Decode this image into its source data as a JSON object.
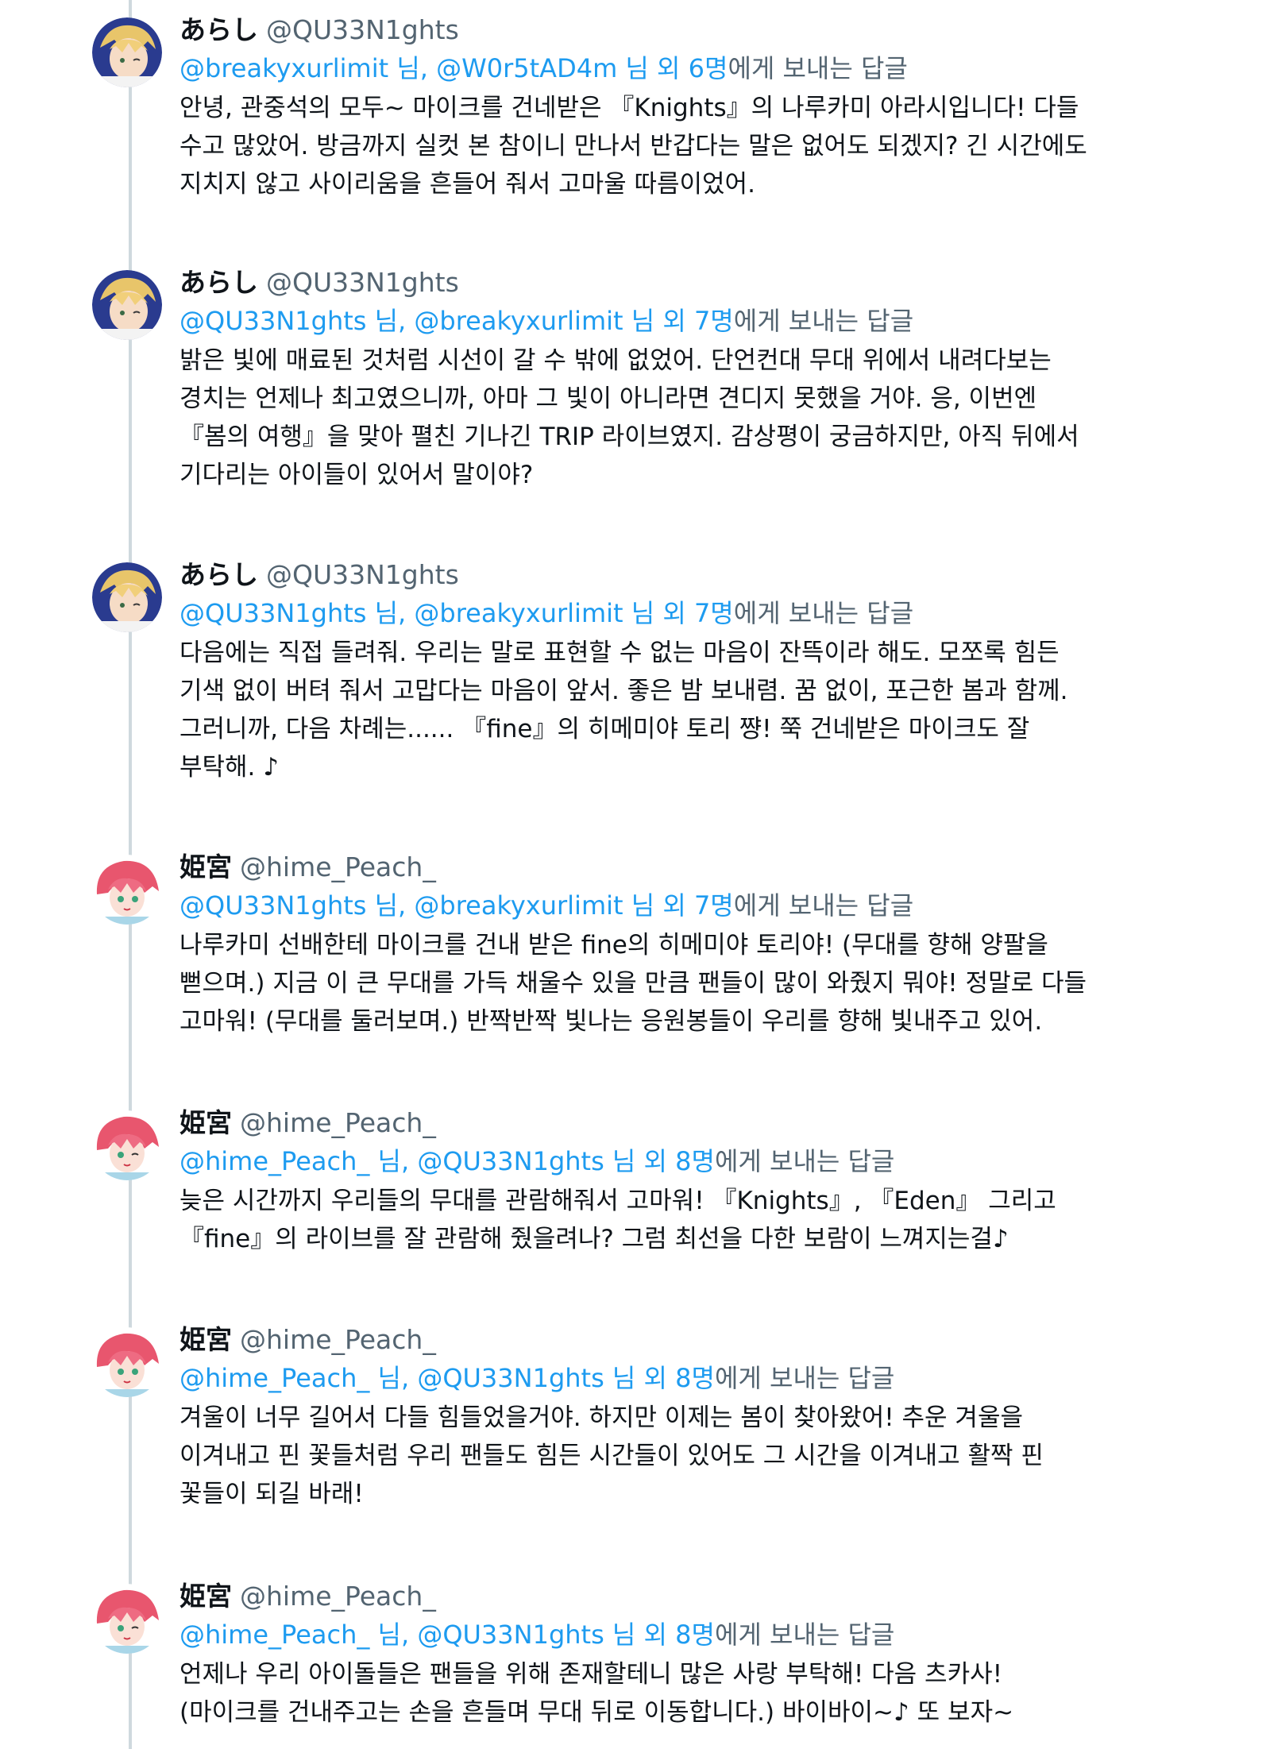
{
  "colors": {
    "link": "#1d9bf0",
    "muted": "#536471",
    "text": "#0f1419",
    "thread_line": "#cfd9de"
  },
  "tweets": [
    {
      "avatar": "arashi-avatar",
      "name": "あらし",
      "handle": "@QU33N1ghts",
      "mentions": "@breakyxurlimit 님, @W0r5tAD4m 님 외 6명",
      "reply_text": "에게 보내는 답글",
      "body": "안녕, 관중석의 모두~ 마이크를 건네받은 『Knights』의 나루카미 아라시입니다! 다들\n수고 많았어. 방금까지 실컷 본 참이니 만나서 반갑다는 말은 없어도 되겠지? 긴 시간에도\n지치지 않고 사이리움을 흔들어 줘서 고마울 따름이었어."
    },
    {
      "avatar": "arashi-avatar",
      "name": "あらし",
      "handle": "@QU33N1ghts",
      "mentions": "@QU33N1ghts 님, @breakyxurlimit 님 외 7명",
      "reply_text": "에게 보내는 답글",
      "body": "밝은 빛에 매료된 것처럼 시선이 갈 수 밖에 없었어. 단언컨대 무대 위에서 내려다보는\n경치는 언제나 최고였으니까, 아마 그 빛이 아니라면 견디지 못했을 거야. 응, 이번엔\n『봄의 여행』을 맞아 펼친 기나긴 TRIP 라이브였지. 감상평이 궁금하지만, 아직 뒤에서\n기다리는 아이들이 있어서 말이야?"
    },
    {
      "avatar": "arashi-avatar",
      "name": "あらし",
      "handle": "@QU33N1ghts",
      "mentions": "@QU33N1ghts 님, @breakyxurlimit 님 외 7명",
      "reply_text": "에게 보내는 답글",
      "body": "다음에는 직접 들려줘. 우리는 말로 표현할 수 없는 마음이 잔뜩이라 해도. 모쪼록 힘든\n기색 없이 버텨 줘서 고맙다는 마음이 앞서. 좋은 밤 보내렴. 꿈 없이, 포근한 봄과 함께.\n그러니까, 다음 차례는...... 『fine』의 히메미야 토리 쨩! 쭉 건네받은 마이크도 잘\n부탁해. ♪"
    },
    {
      "avatar": "hime-avatar",
      "name": "姫宮",
      "handle": "@hime_Peach_",
      "mentions": "@QU33N1ghts 님, @breakyxurlimit 님 외 7명",
      "reply_text": "에게 보내는 답글",
      "body": "나루카미 선배한테 마이크를 건내 받은 fine의 히메미야 토리야! (무대를 향해 양팔을\n뻗으며.) 지금 이 큰 무대를 가득 채울수 있을 만큼 팬들이 많이 와줬지 뭐야! 정말로 다들\n고마워! (무대를 둘러보며.) 반짝반짝 빛나는 응원봉들이 우리를 향해 빛내주고 있어."
    },
    {
      "avatar": "hime-avatar",
      "name": "姫宮",
      "handle": "@hime_Peach_",
      "mentions": "@hime_Peach_ 님, @QU33N1ghts 님 외 8명",
      "reply_text": "에게 보내는 답글",
      "body": "늦은 시간까지 우리들의 무대를 관람해줘서 고마워! 『Knights』, 『Eden』 그리고\n『fine』의 라이브를 잘 관람해 줬을려나? 그럼 최선을 다한 보람이 느껴지는걸♪"
    },
    {
      "avatar": "hime-avatar",
      "name": "姫宮",
      "handle": "@hime_Peach_",
      "mentions": "@hime_Peach_ 님, @QU33N1ghts 님 외 8명",
      "reply_text": "에게 보내는 답글",
      "body": "겨울이 너무 길어서 다들 힘들었을거야. 하지만 이제는 봄이 찾아왔어! 추운 겨울을\n이겨내고 핀 꽃들처럼 우리 팬들도 힘든 시간들이 있어도 그 시간을 이겨내고 활짝 핀\n꽃들이 되길 바래!"
    },
    {
      "avatar": "hime-avatar",
      "name": "姫宮",
      "handle": "@hime_Peach_",
      "mentions": "@hime_Peach_ 님, @QU33N1ghts 님 외 8명",
      "reply_text": "에게 보내는 답글",
      "body": "언제나 우리 아이돌들은 팬들을 위해 존재할테니 많은 사랑 부탁해! 다음 츠카사!\n(마이크를 건내주고는 손을 흔들며 무대 뒤로 이동합니다.) 바이바이~♪ 또 보자~"
    }
  ]
}
